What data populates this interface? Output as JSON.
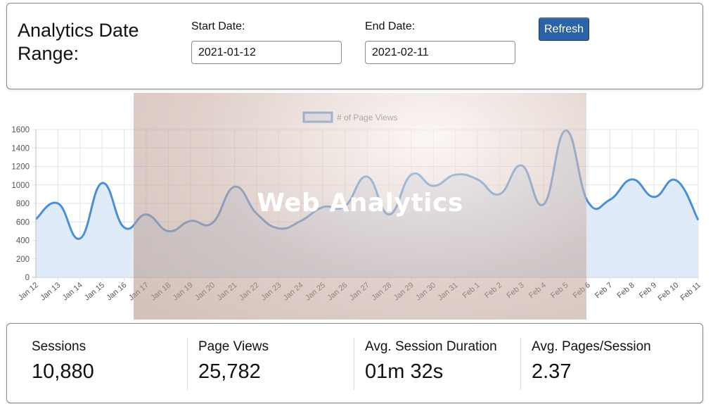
{
  "header": {
    "title": "Analytics Date Range:",
    "start_label": "Start Date:",
    "start_value": "2021-01-12",
    "end_label": "End Date:",
    "end_value": "2021-02-11",
    "refresh_label": "Refresh"
  },
  "overlay": {
    "title": "Web Analytics"
  },
  "stats": [
    {
      "label": "Sessions",
      "value": "10,880"
    },
    {
      "label": "Page Views",
      "value": "25,782"
    },
    {
      "label": "Avg. Session Duration",
      "value": "01m 32s"
    },
    {
      "label": "Avg. Pages/Session",
      "value": "2.37"
    }
  ],
  "colors": {
    "line": "#4a90d9",
    "fill": "#d9e8f8",
    "button": "#2c63a6"
  },
  "chart_data": {
    "type": "area",
    "categories": [
      "Jan 12",
      "Jan 13",
      "Jan 14",
      "Jan 15",
      "Jan 16",
      "Jan 17",
      "Jan 18",
      "Jan 19",
      "Jan 20",
      "Jan 21",
      "Jan 22",
      "Jan 23",
      "Jan 24",
      "Jan 25",
      "Jan 26",
      "Jan 27",
      "Jan 28",
      "Jan 29",
      "Jan 30",
      "Jan 31",
      "Feb 1",
      "Feb 2",
      "Feb 3",
      "Feb 4",
      "Feb 5",
      "Feb 6",
      "Feb 7",
      "Feb 8",
      "Feb 9",
      "Feb 10",
      "Feb 11"
    ],
    "series": [
      {
        "name": "# of Page Views",
        "values": [
          630,
          800,
          420,
          1020,
          540,
          680,
          500,
          610,
          590,
          980,
          690,
          530,
          610,
          760,
          770,
          1090,
          680,
          1110,
          990,
          1110,
          1060,
          900,
          1210,
          790,
          1590,
          820,
          840,
          1060,
          870,
          1050,
          620
        ]
      }
    ],
    "y_ticks": [
      0,
      200,
      400,
      600,
      800,
      1000,
      1200,
      1400,
      1600
    ],
    "ylim": [
      0,
      1600
    ],
    "grid": true,
    "legend": "top-center"
  }
}
